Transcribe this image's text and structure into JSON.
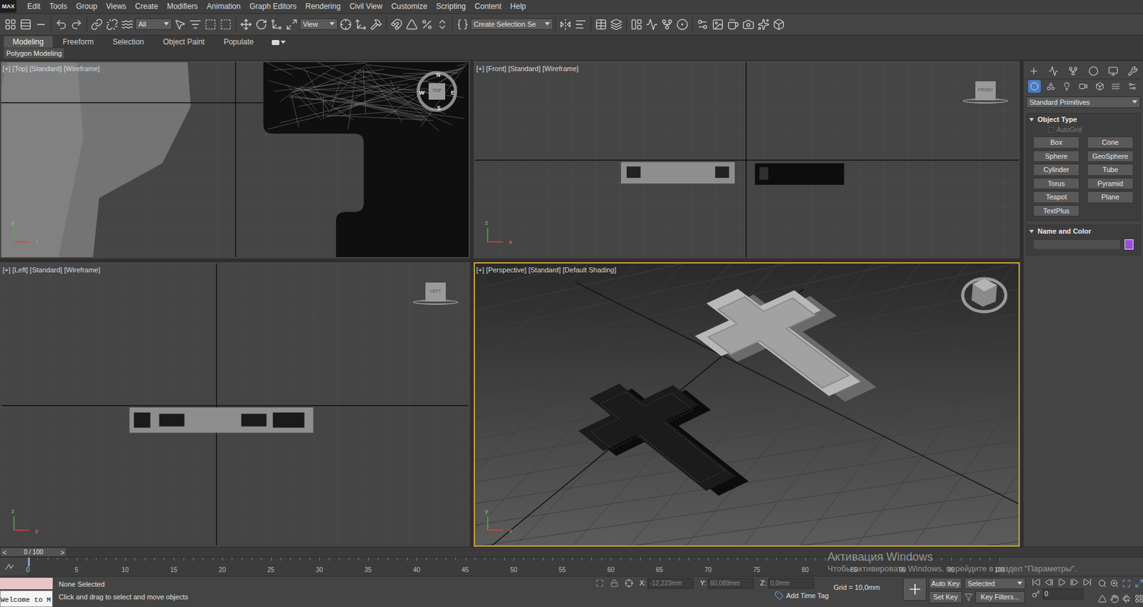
{
  "app": {
    "logo": "MAX"
  },
  "menu": [
    "Edit",
    "Tools",
    "Group",
    "Views",
    "Create",
    "Modifiers",
    "Animation",
    "Graph Editors",
    "Rendering",
    "Civil View",
    "Customize",
    "Scripting",
    "Content",
    "Help"
  ],
  "toolbar": {
    "selection_filter": "All",
    "reference_coordinate": "View",
    "named_selection": "Create Selection Se"
  },
  "ribbon": {
    "tabs": [
      {
        "label": "Modeling",
        "selected": true
      },
      {
        "label": "Freeform",
        "selected": false
      },
      {
        "label": "Selection",
        "selected": false
      },
      {
        "label": "Object Paint",
        "selected": false
      },
      {
        "label": "Populate",
        "selected": false
      }
    ],
    "panel": "Polygon Modeling"
  },
  "viewports": [
    {
      "kind": "top",
      "label": "[+] [Top] [Standard] [Wireframe]",
      "active": false,
      "viewcube": "TOP",
      "compass": [
        "N",
        "E",
        "S",
        "W"
      ],
      "axis_labels": {
        "up": "y",
        "right": "x"
      }
    },
    {
      "kind": "front",
      "label": "[+] [Front] [Standard] [Wireframe]",
      "active": false,
      "viewcube": "FRONT",
      "compass": [],
      "axis_labels": {
        "up": "z",
        "right": "x"
      }
    },
    {
      "kind": "left",
      "label": "[+] [Left] [Standard] [Wireframe]",
      "active": false,
      "viewcube": "LEFT",
      "compass": [],
      "axis_labels": {
        "up": "z",
        "right": "y"
      }
    },
    {
      "kind": "perspective",
      "label": "[+] [Perspective] [Standard] [Default Shading]",
      "active": true,
      "viewcube": "",
      "compass": [],
      "axis_labels": {
        "up": "y",
        "right": "x"
      }
    }
  ],
  "command_panel": {
    "categories": [
      {
        "selected": true
      },
      {
        "selected": false
      },
      {
        "selected": false
      },
      {
        "selected": false
      },
      {
        "selected": false
      },
      {
        "selected": false
      },
      {
        "selected": false
      }
    ],
    "dropdown": "Standard Primitives",
    "object_type": {
      "title": "Object Type",
      "expanded": true,
      "autogrid": {
        "label": "AutoGrid",
        "checked": false,
        "disabled": true
      },
      "buttons": [
        "Box",
        "Cone",
        "Sphere",
        "GeoSphere",
        "Cylinder",
        "Tube",
        "Torus",
        "Pyramid",
        "Teapot",
        "Plane",
        "TextPlus"
      ]
    },
    "name_and_color": {
      "title": "Name and Color",
      "expanded": true,
      "name": "",
      "color": "#9c4ed9"
    }
  },
  "time_slider": {
    "label": "0 / 100",
    "prev": "<",
    "next": ">",
    "level": 0
  },
  "track_bar": {
    "ticks": [
      "0",
      "5",
      "10",
      "15",
      "20",
      "25",
      "30",
      "35",
      "40",
      "45",
      "50",
      "55",
      "60",
      "65",
      "70",
      "75",
      "80",
      "85",
      "90",
      "95",
      "100"
    ],
    "current": 0
  },
  "status": {
    "listener": "Welcome to M",
    "selection": "None Selected",
    "prompt": "Click and drag to select and move objects",
    "x": {
      "label": "X:",
      "value": "-12,223mm"
    },
    "y": {
      "label": "Y:",
      "value": "60,089mm"
    },
    "z": {
      "label": "Z:",
      "value": "0,0mm"
    },
    "grid": "Grid = 10,0mm",
    "add_time_tag": "Add Time Tag",
    "auto_key": "Auto Key",
    "key_mode": "Selected",
    "set_key": "Set Key",
    "key_filters": "Key Filters...",
    "frame": "0"
  },
  "watermark": {
    "title": "Активация Windows",
    "subtitle": "Чтобы активировать Windows, перейдите в раздел \"Параметры\"."
  }
}
